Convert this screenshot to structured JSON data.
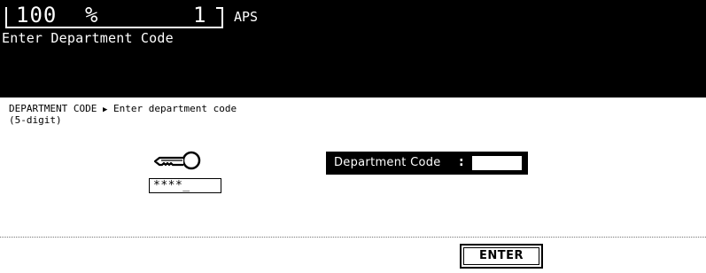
{
  "status": {
    "zoom_value": "100",
    "zoom_unit": "%",
    "copies": "1",
    "paper_mode": "APS",
    "message": "Enter Department Code"
  },
  "instruction": {
    "breadcrumb_start": "DEPARTMENT CODE",
    "arrow": "▶",
    "breadcrumb_end": "Enter department code",
    "line2": "(5-digit)"
  },
  "key": {
    "icon": "key-icon",
    "mask": "****_"
  },
  "department_field": {
    "label": "Department Code",
    "colon": ":",
    "value": ""
  },
  "actions": {
    "enter_label": "ENTER"
  }
}
